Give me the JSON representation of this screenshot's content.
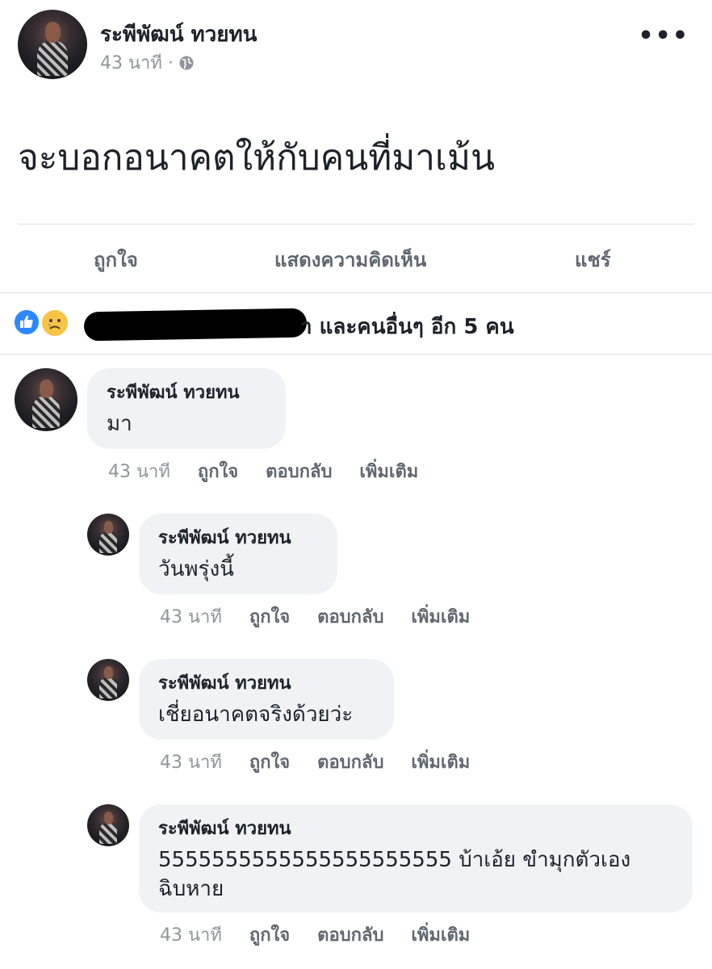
{
  "post": {
    "author": "ระพีพัฒน์ ทวยทน",
    "time": "43 นาที ·",
    "text": "จะบอกอนาคตให้กับคนที่มาเม้น"
  },
  "actions": {
    "like": "ถูกใจ",
    "comment": "แสดงความคิดเห็น",
    "share": "แชร์"
  },
  "reactions": {
    "text": "า และคนอื่นๆ อีก 5 คน"
  },
  "comment_actions": {
    "like": "ถูกใจ",
    "reply": "ตอบกลับ",
    "more": "เพิ่มเติม"
  },
  "comments": [
    {
      "author": "ระพีพัฒน์ ทวยทน",
      "text": "มา",
      "time": "43 นาที"
    },
    {
      "author": "ระพีพัฒน์ ทวยทน",
      "text": "วันพรุ่งนี้",
      "time": "43 นาที"
    },
    {
      "author": "ระพีพัฒน์ ทวยทน",
      "text": "เชี่ยอนาคตจริงด้วยว่ะ",
      "time": "43 นาที"
    },
    {
      "author": "ระพีพัฒน์ ทวยทน",
      "text": "5555555555555555555555 บ้าเอ้ย ขำมุกตัวเองฉิบหาย",
      "time": "43 นาที"
    }
  ],
  "colors": {
    "like_blue": "#2d88ff",
    "sad_yellow": "#f7c447",
    "bubble_bg": "#f0f2f5",
    "muted_text": "#90949c"
  }
}
